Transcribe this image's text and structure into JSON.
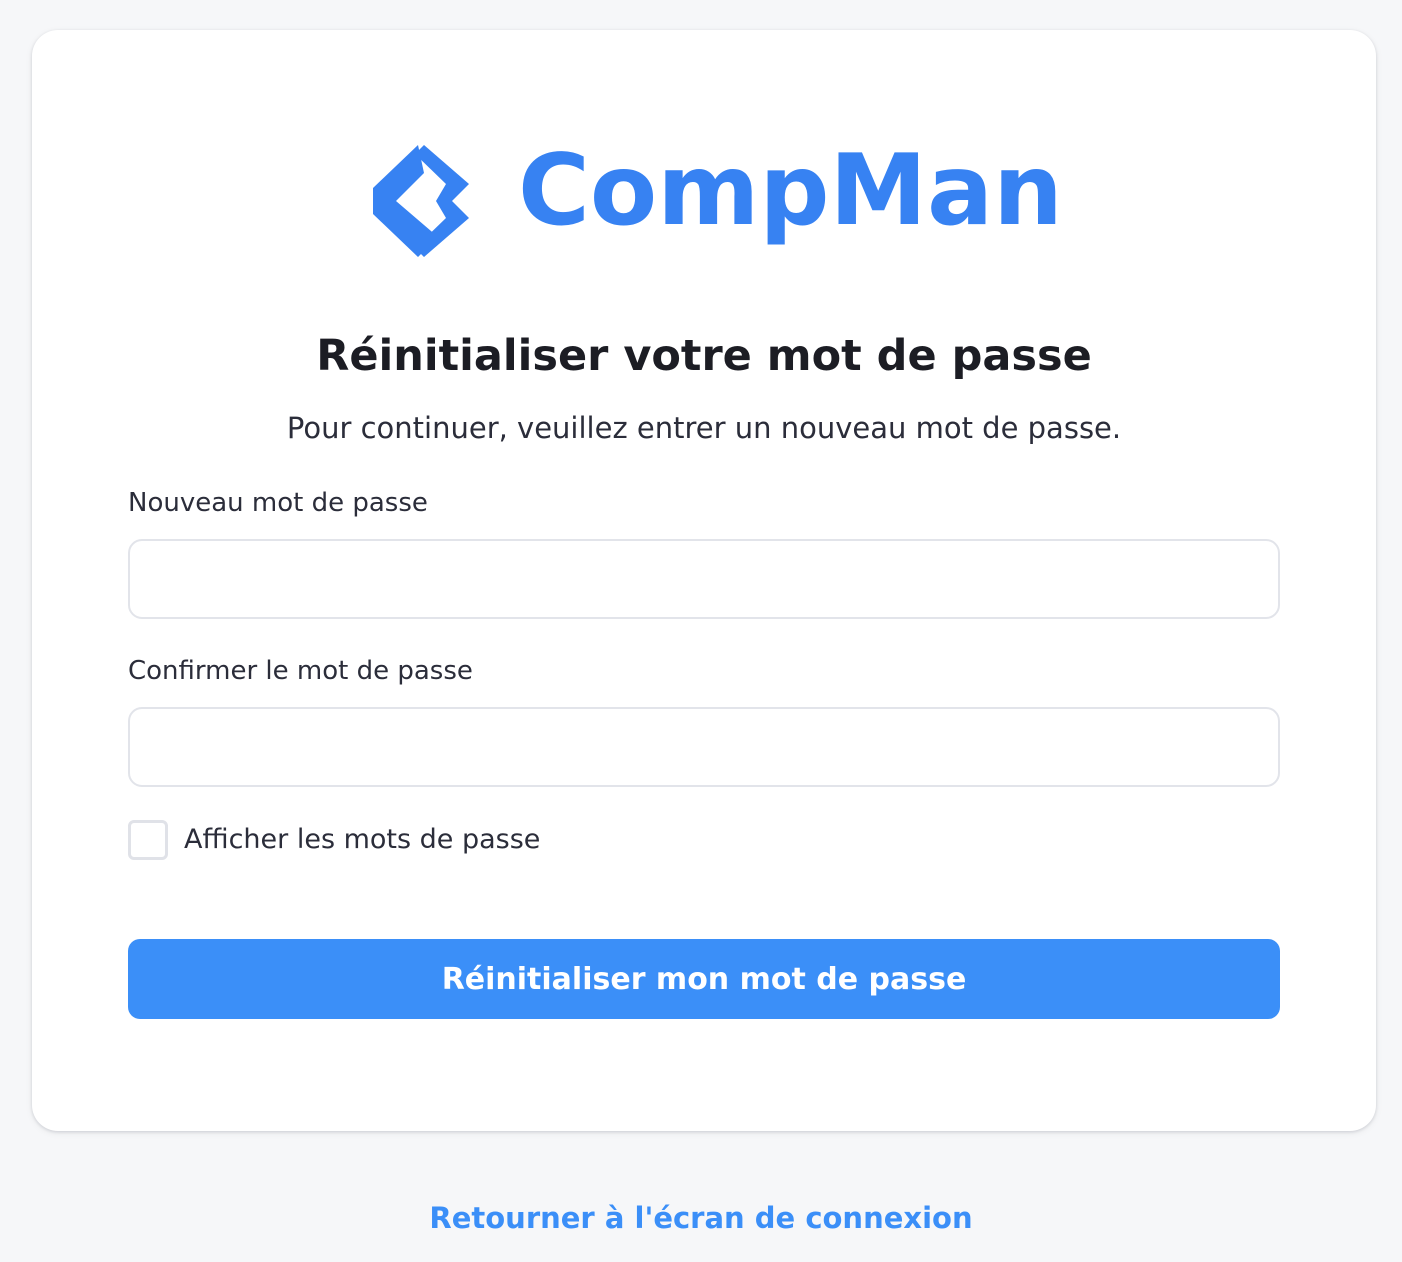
{
  "brand": {
    "name": "CompMan",
    "color": "#3782f2",
    "logo_icon": "compman-logo-icon"
  },
  "form": {
    "title": "Réinitialiser votre mot de passe",
    "subtitle": "Pour continuer, veuillez entrer un nouveau mot de passe.",
    "new_password": {
      "label": "Nouveau mot de passe",
      "value": "",
      "placeholder": ""
    },
    "confirm_password": {
      "label": "Confirmer le mot de passe",
      "value": "",
      "placeholder": ""
    },
    "show_passwords": {
      "label": "Afficher les mots de passe",
      "checked": false
    },
    "submit_label": "Réinitialiser mon mot de passe",
    "submit_color": "#3b8ff8"
  },
  "footer": {
    "back_link_label": "Retourner à l'écran de connexion",
    "link_color": "#3b8ff8"
  }
}
